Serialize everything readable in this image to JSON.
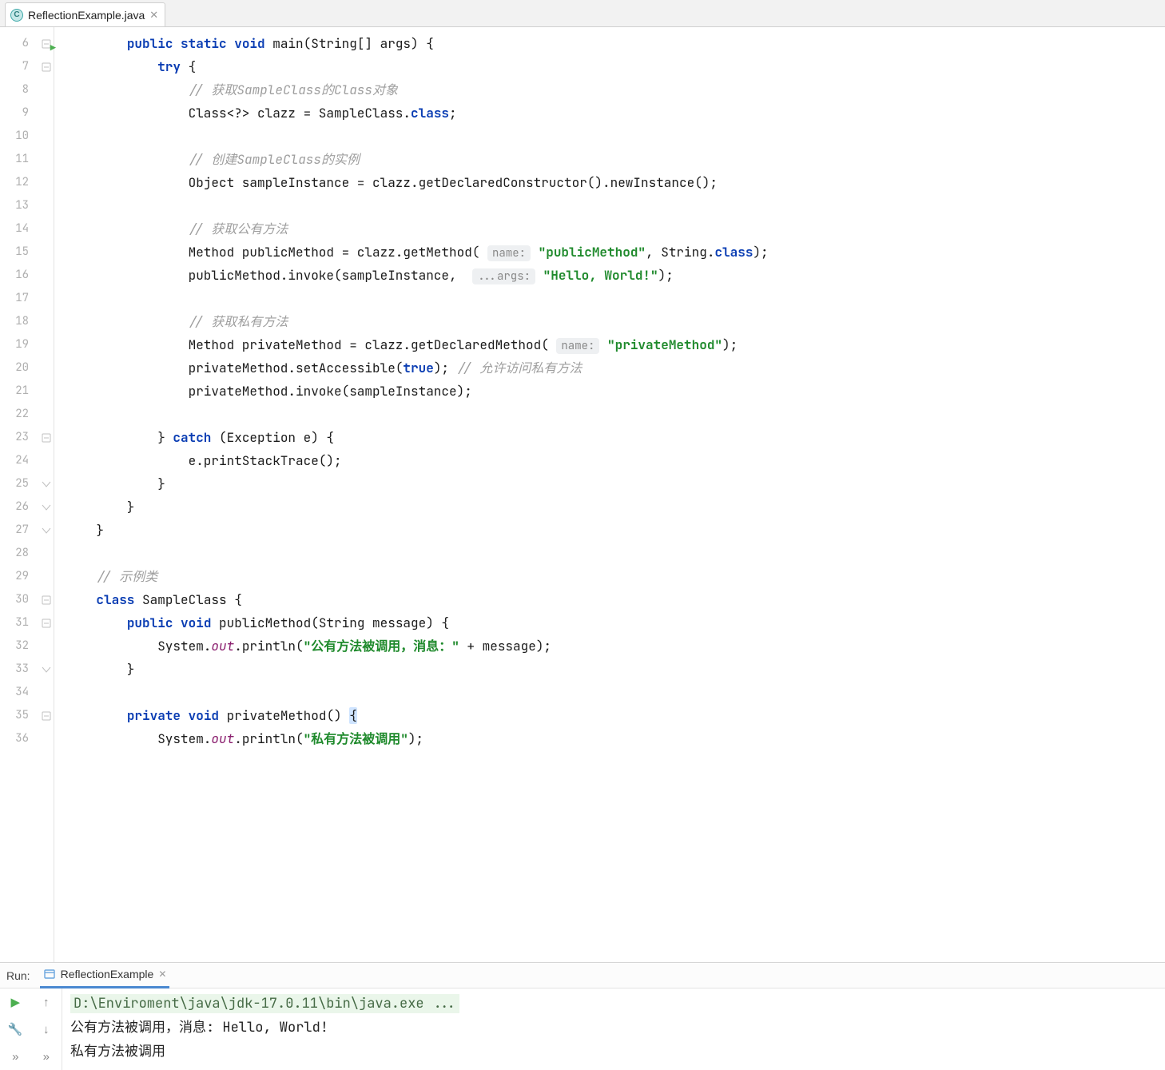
{
  "tab": {
    "filename": "ReflectionExample.java"
  },
  "gutter": {
    "start": 6,
    "end": 36,
    "run_marker_line": 6
  },
  "code": {
    "lines": [
      {
        "n": 6,
        "indent": 2,
        "tokens": [
          {
            "t": "public ",
            "c": "kw"
          },
          {
            "t": "static ",
            "c": "kw"
          },
          {
            "t": "void ",
            "c": "kw"
          },
          {
            "t": "main(String[] args) {"
          }
        ]
      },
      {
        "n": 7,
        "indent": 3,
        "tokens": [
          {
            "t": "try ",
            "c": "kw"
          },
          {
            "t": "{"
          }
        ]
      },
      {
        "n": 8,
        "indent": 4,
        "tokens": [
          {
            "t": "// 获取SampleClass的Class对象",
            "c": "cm"
          }
        ]
      },
      {
        "n": 9,
        "indent": 4,
        "tokens": [
          {
            "t": "Class<?> clazz = SampleClass."
          },
          {
            "t": "class",
            "c": "kw"
          },
          {
            "t": ";"
          }
        ]
      },
      {
        "n": 10,
        "indent": 0,
        "tokens": []
      },
      {
        "n": 11,
        "indent": 4,
        "tokens": [
          {
            "t": "// 创建SampleClass的实例",
            "c": "cm"
          }
        ]
      },
      {
        "n": 12,
        "indent": 4,
        "tokens": [
          {
            "t": "Object sampleInstance = clazz.getDeclaredConstructor().newInstance();"
          }
        ]
      },
      {
        "n": 13,
        "indent": 0,
        "tokens": []
      },
      {
        "n": 14,
        "indent": 4,
        "tokens": [
          {
            "t": "// 获取公有方法",
            "c": "cm"
          }
        ]
      },
      {
        "n": 15,
        "indent": 4,
        "tokens": [
          {
            "t": "Method publicMethod = clazz.getMethod( "
          },
          {
            "t": "name:",
            "c": "hint"
          },
          {
            "t": " "
          },
          {
            "t": "\"publicMethod\"",
            "c": "str"
          },
          {
            "t": ", String."
          },
          {
            "t": "class",
            "c": "kw"
          },
          {
            "t": ");"
          }
        ]
      },
      {
        "n": 16,
        "indent": 4,
        "tokens": [
          {
            "t": "publicMethod.invoke(sampleInstance,  "
          },
          {
            "t": "...args:",
            "c": "hint"
          },
          {
            "t": " "
          },
          {
            "t": "\"Hello, World!\"",
            "c": "str"
          },
          {
            "t": ");"
          }
        ]
      },
      {
        "n": 17,
        "indent": 0,
        "tokens": []
      },
      {
        "n": 18,
        "indent": 4,
        "tokens": [
          {
            "t": "// 获取私有方法",
            "c": "cm"
          }
        ]
      },
      {
        "n": 19,
        "indent": 4,
        "tokens": [
          {
            "t": "Method privateMethod = clazz.getDeclaredMethod( "
          },
          {
            "t": "name:",
            "c": "hint"
          },
          {
            "t": " "
          },
          {
            "t": "\"privateMethod\"",
            "c": "str"
          },
          {
            "t": ");"
          }
        ]
      },
      {
        "n": 20,
        "indent": 4,
        "tokens": [
          {
            "t": "privateMethod.setAccessible("
          },
          {
            "t": "true",
            "c": "kw"
          },
          {
            "t": "); "
          },
          {
            "t": "// 允许访问私有方法",
            "c": "cm"
          }
        ]
      },
      {
        "n": 21,
        "indent": 4,
        "tokens": [
          {
            "t": "privateMethod.invoke(sampleInstance);"
          }
        ]
      },
      {
        "n": 22,
        "indent": 0,
        "tokens": []
      },
      {
        "n": 23,
        "indent": 3,
        "tokens": [
          {
            "t": "} "
          },
          {
            "t": "catch ",
            "c": "kw"
          },
          {
            "t": "(Exception e) {"
          }
        ]
      },
      {
        "n": 24,
        "indent": 4,
        "tokens": [
          {
            "t": "e.printStackTrace();"
          }
        ]
      },
      {
        "n": 25,
        "indent": 3,
        "tokens": [
          {
            "t": "}"
          }
        ]
      },
      {
        "n": 26,
        "indent": 2,
        "tokens": [
          {
            "t": "}"
          }
        ]
      },
      {
        "n": 27,
        "indent": 1,
        "tokens": [
          {
            "t": "}"
          }
        ]
      },
      {
        "n": 28,
        "indent": 0,
        "tokens": []
      },
      {
        "n": 29,
        "indent": 1,
        "tokens": [
          {
            "t": "// 示例类",
            "c": "cm"
          }
        ]
      },
      {
        "n": 30,
        "indent": 1,
        "tokens": [
          {
            "t": "class ",
            "c": "kw"
          },
          {
            "t": "SampleClass {"
          }
        ]
      },
      {
        "n": 31,
        "indent": 2,
        "tokens": [
          {
            "t": "public ",
            "c": "kw"
          },
          {
            "t": "void ",
            "c": "kw"
          },
          {
            "t": "publicMethod(String message) {"
          }
        ]
      },
      {
        "n": 32,
        "indent": 3,
        "tokens": [
          {
            "t": "System."
          },
          {
            "t": "out",
            "c": "fld"
          },
          {
            "t": ".println("
          },
          {
            "t": "\"公有方法被调用，消息：\"",
            "c": "str"
          },
          {
            "t": " + message);"
          }
        ]
      },
      {
        "n": 33,
        "indent": 2,
        "tokens": [
          {
            "t": "}"
          }
        ]
      },
      {
        "n": 34,
        "indent": 0,
        "tokens": []
      },
      {
        "n": 35,
        "indent": 2,
        "caret": true,
        "tokens": [
          {
            "t": "private ",
            "c": "kw"
          },
          {
            "t": "void ",
            "c": "kw"
          },
          {
            "t": "privateMethod() "
          },
          {
            "t": "{",
            "c": "brace-hl"
          }
        ]
      },
      {
        "n": 36,
        "indent": 3,
        "tokens": [
          {
            "t": "System."
          },
          {
            "t": "out",
            "c": "fld"
          },
          {
            "t": ".println("
          },
          {
            "t": "\"私有方法被调用\"",
            "c": "str"
          },
          {
            "t": ");"
          }
        ]
      }
    ],
    "fold_markers": {
      "6": "open",
      "7": "open",
      "23": "open",
      "25": "close",
      "26": "close",
      "27": "close",
      "30": "open",
      "31": "open",
      "33": "close",
      "35": "open"
    }
  },
  "run": {
    "label": "Run:",
    "config": "ReflectionExample",
    "cmd": "D:\\Enviroment\\java\\jdk-17.0.11\\bin\\java.exe ...",
    "output": [
      "公有方法被调用，消息: Hello, World!",
      "私有方法被调用"
    ]
  }
}
